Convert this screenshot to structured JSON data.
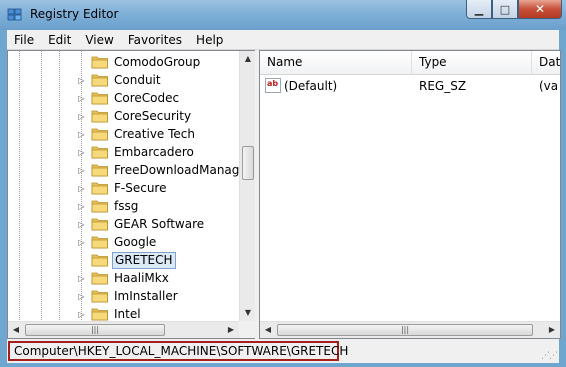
{
  "window": {
    "title": "Registry Editor"
  },
  "menu": [
    "File",
    "Edit",
    "View",
    "Favorites",
    "Help"
  ],
  "tree": {
    "items": [
      {
        "label": "ComodoGroup",
        "expandable": false,
        "selected": false
      },
      {
        "label": "Conduit",
        "expandable": true,
        "selected": false
      },
      {
        "label": "CoreCodec",
        "expandable": true,
        "selected": false
      },
      {
        "label": "CoreSecurity",
        "expandable": true,
        "selected": false
      },
      {
        "label": "Creative Tech",
        "expandable": true,
        "selected": false
      },
      {
        "label": "Embarcadero",
        "expandable": true,
        "selected": false
      },
      {
        "label": "FreeDownloadManager.",
        "expandable": true,
        "selected": false
      },
      {
        "label": "F-Secure",
        "expandable": true,
        "selected": false
      },
      {
        "label": "fssg",
        "expandable": true,
        "selected": false
      },
      {
        "label": "GEAR Software",
        "expandable": true,
        "selected": false
      },
      {
        "label": "Google",
        "expandable": true,
        "selected": false
      },
      {
        "label": "GRETECH",
        "expandable": false,
        "selected": true
      },
      {
        "label": "HaaliMkx",
        "expandable": true,
        "selected": false
      },
      {
        "label": "ImInstaller",
        "expandable": true,
        "selected": false
      },
      {
        "label": "Intel",
        "expandable": true,
        "selected": false
      }
    ]
  },
  "list": {
    "columns": [
      "Name",
      "Type",
      "Dat"
    ],
    "rows": [
      {
        "name": "(Default)",
        "type": "REG_SZ",
        "data": "(va",
        "icon": "string-value-icon"
      }
    ]
  },
  "status": {
    "path": "Computer\\HKEY_LOCAL_MACHINE\\SOFTWARE\\GRETECH"
  },
  "colors": {
    "frame": "#6fa6cf",
    "highlight_border": "#a61e1e",
    "selection": "#dceaf8"
  }
}
